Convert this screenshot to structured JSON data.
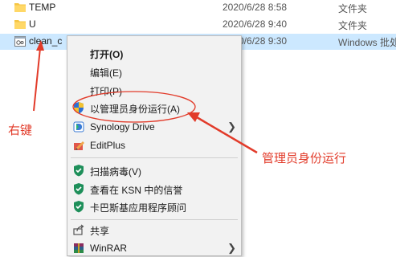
{
  "files": [
    {
      "name": "TEMP",
      "date": "2020/6/28 8:58",
      "type": "文件夹"
    },
    {
      "name": "U",
      "date": "2020/6/28 9:40",
      "type": "文件夹"
    },
    {
      "name": "clean_c",
      "date": "2020/6/28 9:30",
      "type": "Windows 批处"
    }
  ],
  "menu": {
    "open": "打开(O)",
    "edit": "编辑(E)",
    "print": "打印(P)",
    "run_as_admin": "以管理员身份运行(A)",
    "synology": "Synology Drive",
    "editplus": "EditPlus",
    "scan": "扫描病毒(V)",
    "ksn": "查看在 KSN 中的信誉",
    "kaspersky": "卡巴斯基应用程序顾问",
    "share": "共享",
    "winrar": "WinRAR"
  },
  "annotations": {
    "right_click": "右键",
    "admin_run": "管理员身份运行",
    "color": "#e23b2a"
  },
  "colors": {
    "selection": "#cce8ff",
    "menu_bg": "#f2f2f2",
    "folder": "#f5c542",
    "shield_green": "#1e8f5a"
  }
}
